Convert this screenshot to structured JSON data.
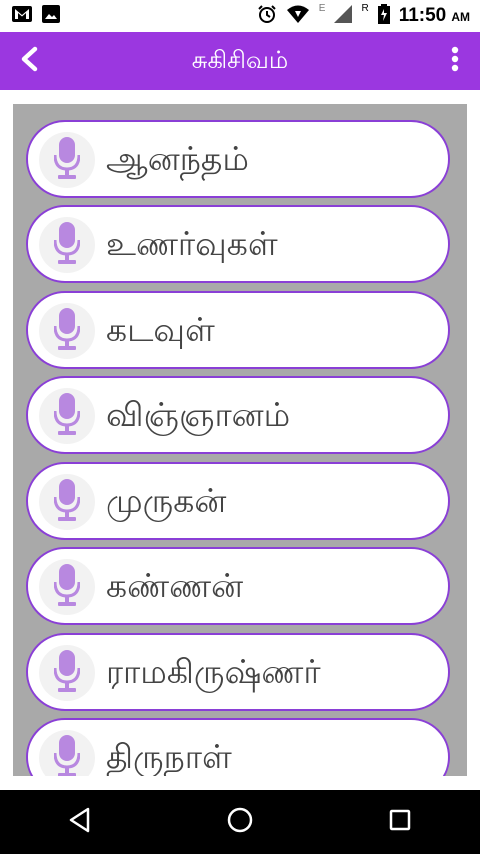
{
  "status_bar": {
    "time": "11:50",
    "time_suffix": "AM",
    "network_label": "E",
    "roaming_label": "R",
    "icons": [
      "gmail-icon",
      "gallery-icon",
      "alarm-icon",
      "wifi-icon",
      "signal-icon",
      "battery-icon"
    ]
  },
  "app_bar": {
    "title": "சுகிசிவம்",
    "back_icon": "back-chevron-icon",
    "menu_icon": "overflow-menu-icon",
    "color": "#9b37e0"
  },
  "list": {
    "items": [
      {
        "label": "ஆனந்தம்",
        "icon": "microphone-icon"
      },
      {
        "label": "உணர்வுகள்",
        "icon": "microphone-icon"
      },
      {
        "label": "கடவுள்",
        "icon": "microphone-icon"
      },
      {
        "label": "விஞ்ஞானம்",
        "icon": "microphone-icon"
      },
      {
        "label": "முருகன்",
        "icon": "microphone-icon"
      },
      {
        "label": "கண்ணன்",
        "icon": "microphone-icon"
      },
      {
        "label": "ராமகிருஷ்ணர்",
        "icon": "microphone-icon"
      },
      {
        "label": "திருநாள்",
        "icon": "microphone-icon"
      }
    ],
    "mic_color": "#b888e0",
    "border_color": "#8a3fd6"
  },
  "nav_bar": {
    "buttons": [
      "back-triangle-icon",
      "home-circle-icon",
      "recents-square-icon"
    ]
  }
}
